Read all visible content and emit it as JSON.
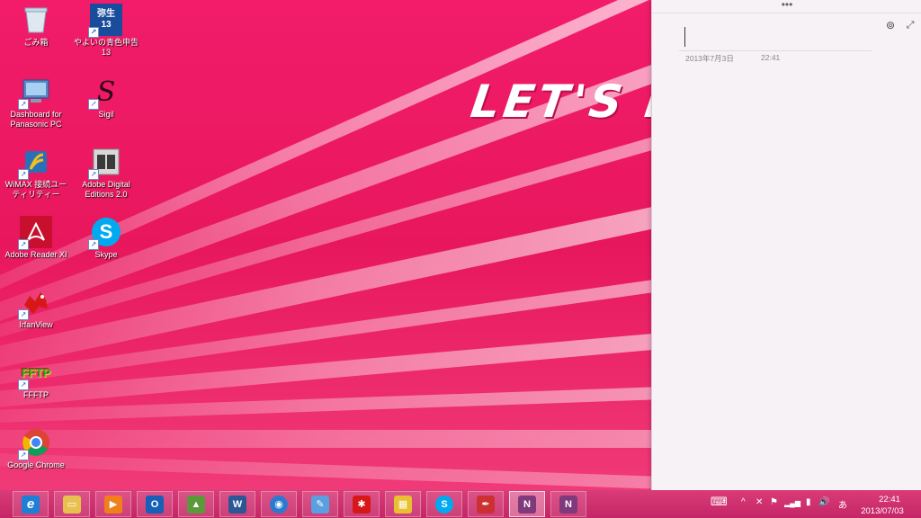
{
  "wallpaper": {
    "logo_text": "LET'S no"
  },
  "desktop_icons": [
    {
      "label": "ごみ箱",
      "icon": "recycle-bin-icon"
    },
    {
      "label": "やよいの青色申告 13",
      "icon": "yayoi-icon",
      "badge_top": "弥生",
      "badge_bottom": "13"
    },
    {
      "label": "Dashboard for Panasonic PC",
      "icon": "dashboard-icon"
    },
    {
      "label": "Sigil",
      "icon": "sigil-icon",
      "glyph": "S"
    },
    {
      "label": "WiMAX 接続ユーティリティー",
      "icon": "wimax-icon"
    },
    {
      "label": "Adobe Digital Editions 2.0",
      "icon": "adobe-digital-editions-icon"
    },
    {
      "label": "Adobe Reader XI",
      "icon": "adobe-reader-icon"
    },
    {
      "label": "Skype",
      "icon": "skype-icon",
      "glyph": "S"
    },
    {
      "label": "IrfanView",
      "icon": "irfanview-icon"
    },
    {
      "label": "FFFTP",
      "icon": "ffftp-icon",
      "glyph": "FFTP"
    },
    {
      "label": "Google Chrome",
      "icon": "chrome-icon"
    }
  ],
  "notes_panel": {
    "menu_dots": "•••",
    "date": "2013年7月3日",
    "time": "22:41",
    "link_glyph": "⊚",
    "expand_glyph": "⤢"
  },
  "taskbar": {
    "apps": [
      {
        "name": "internet-explorer",
        "glyph": "e",
        "color": "#1e7fd6"
      },
      {
        "name": "file-explorer",
        "glyph": "▭",
        "color": "#e8c050"
      },
      {
        "name": "media-player",
        "glyph": "▶",
        "color": "#f0801c"
      },
      {
        "name": "outlook",
        "glyph": "O",
        "color": "#1660b8"
      },
      {
        "name": "photo-app",
        "glyph": "▲",
        "color": "#5a9a3a"
      },
      {
        "name": "word",
        "glyph": "W",
        "color": "#2b5797"
      },
      {
        "name": "globe-app",
        "glyph": "◉",
        "color": "#2a7ad0"
      },
      {
        "name": "paint-app",
        "glyph": "✎",
        "color": "#5aa0e0"
      },
      {
        "name": "irfanview",
        "glyph": "✱",
        "color": "#d81818"
      },
      {
        "name": "media-organizer",
        "glyph": "▦",
        "color": "#e8c030"
      },
      {
        "name": "skype",
        "glyph": "S",
        "color": "#00a9f0"
      },
      {
        "name": "pen-app",
        "glyph": "✒",
        "color": "#cc3030"
      },
      {
        "name": "onenote",
        "glyph": "N",
        "color": "#80397b",
        "active": true
      },
      {
        "name": "onenote-clipper",
        "glyph": "N",
        "color": "#80397b"
      }
    ],
    "tray": {
      "keyboard": "⌨",
      "chevron": "^",
      "network_off": "✕",
      "flag": "⚑",
      "signal": "▂▄▆",
      "battery": "▮",
      "volume": "🔊",
      "ime": "あ"
    },
    "clock_time": "22:41",
    "clock_date": "2013/07/03"
  }
}
